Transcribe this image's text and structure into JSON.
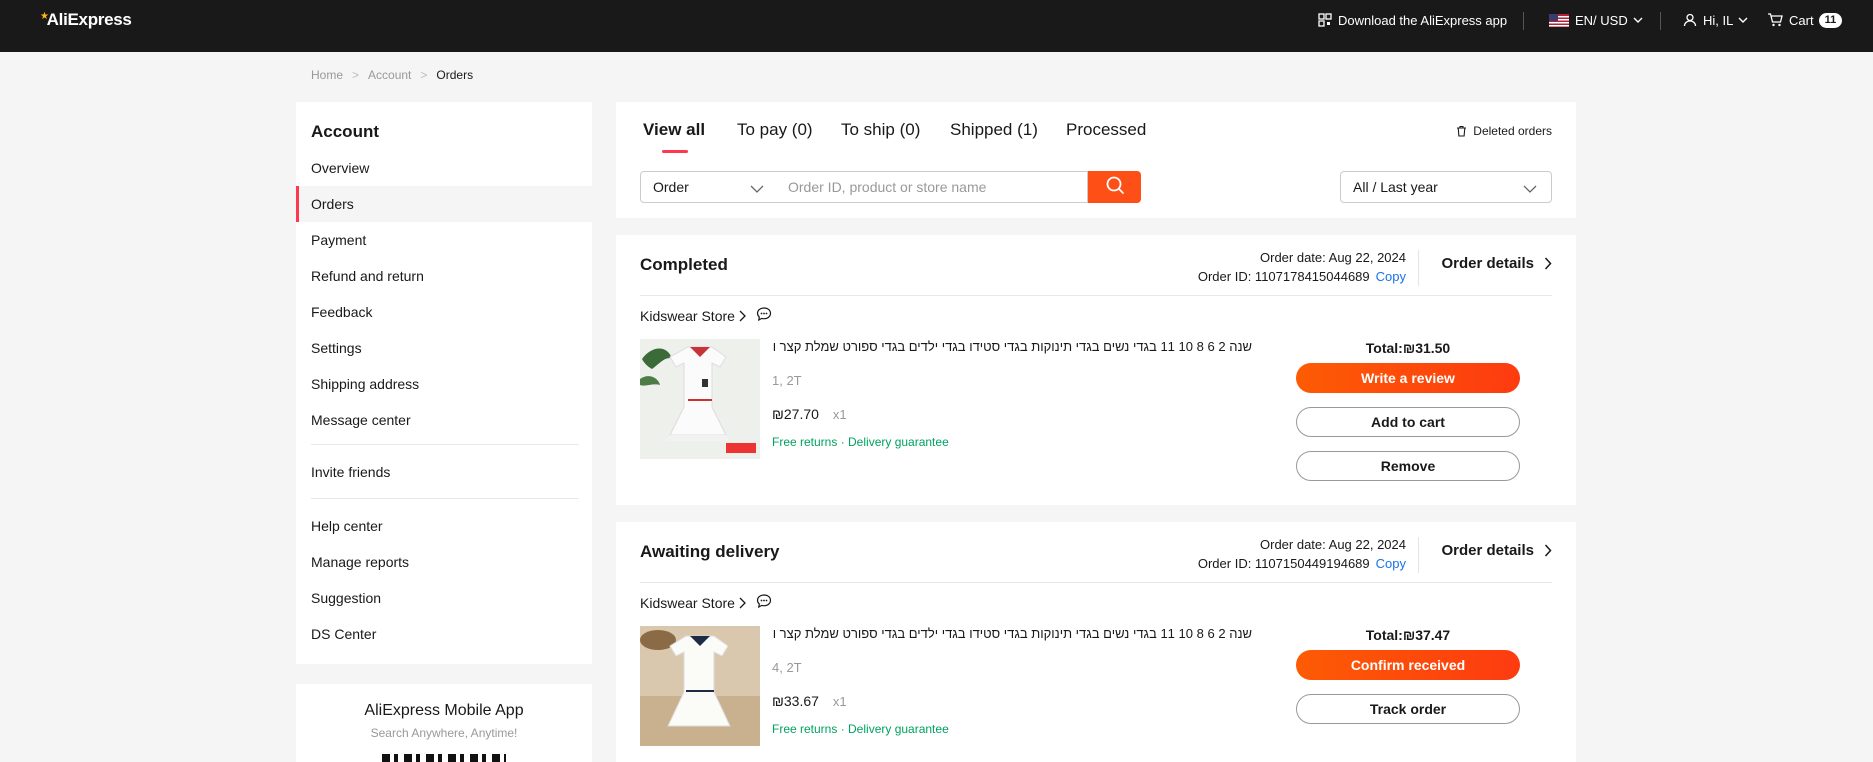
{
  "topbar": {
    "logo": "AliExpress",
    "download_app": "Download the AliExpress app",
    "locale": "EN/ USD",
    "user": "Hi, IL",
    "cart_label": "Cart",
    "cart_count": "11"
  },
  "breadcrumb": {
    "home": "Home",
    "account": "Account",
    "current": "Orders"
  },
  "sidebar": {
    "title": "Account",
    "items": [
      "Overview",
      "Orders",
      "Payment",
      "Refund and return",
      "Feedback",
      "Settings",
      "Shipping address",
      "Message center",
      "Invite friends",
      "Help center",
      "Manage reports",
      "Suggestion",
      "DS Center"
    ],
    "active": "Orders"
  },
  "app_card": {
    "title": "AliExpress Mobile App",
    "subtitle": "Search Anywhere, Anytime!"
  },
  "tabs": {
    "items": [
      "View all",
      "To pay (0)",
      "To ship (0)",
      "Shipped (1)",
      "Processed"
    ],
    "active": "View all",
    "deleted_orders": "Deleted orders"
  },
  "search": {
    "type_value": "Order",
    "placeholder": "Order ID, product or store name",
    "period_value": "All / Last year"
  },
  "orders": [
    {
      "status": "Completed",
      "order_date": "Order date: Aug 22, 2024",
      "order_id": "Order ID: 1107178415044689",
      "copy": "Copy",
      "details": "Order details",
      "store": "Kidswear Store",
      "title": "שנה 2 6 8 10 11 בגדי נשים בגדי תינוקות בגדי סטידו בגדי ילדים בגדי ספורט שמלת קצר ול...",
      "sku": "1, 2T",
      "price": "₪27.70",
      "qty": "x1",
      "tags": "Free returns · Delivery guarantee",
      "total": "Total:₪31.50",
      "buttons": [
        "Write a review",
        "Add to cart",
        "Remove"
      ]
    },
    {
      "status": "Awaiting delivery",
      "order_date": "Order date: Aug 22, 2024",
      "order_id": "Order ID: 1107150449194689",
      "copy": "Copy",
      "details": "Order details",
      "store": "Kidswear Store",
      "title": "שנה 2 6 8 10 11 בגדי נשים בגדי תינוקות בגדי סטידו בגדי ילדים בגדי ספורט שמלת קצר ול...",
      "sku": "4, 2T",
      "price": "₪33.67",
      "qty": "x1",
      "tags": "Free returns · Delivery guarantee",
      "total": "Total:₪37.47",
      "buttons": [
        "Confirm received",
        "Track order"
      ]
    }
  ]
}
